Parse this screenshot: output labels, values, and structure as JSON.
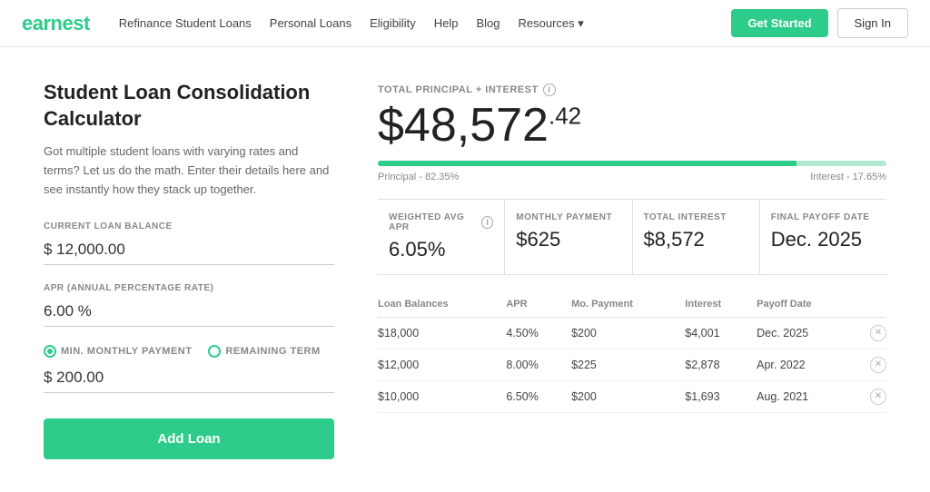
{
  "logo": "earnest",
  "nav": {
    "items": [
      {
        "label": "Refinance Student Loans"
      },
      {
        "label": "Personal Loans"
      },
      {
        "label": "Eligibility"
      },
      {
        "label": "Help"
      },
      {
        "label": "Blog"
      },
      {
        "label": "Resources ▾"
      }
    ]
  },
  "header_actions": {
    "get_started": "Get Started",
    "sign_in": "Sign In"
  },
  "calculator": {
    "title": "Student Loan Consolidation Calculator",
    "description": "Got multiple student loans with varying rates and terms? Let us do the math. Enter their details here and see instantly how they stack up together.",
    "balance_label": "CURRENT LOAN BALANCE",
    "balance_value": "$ 12,000.00",
    "apr_label": "APR (ANNUAL PERCENTAGE RATE)",
    "apr_value": "6.00 %",
    "payment_type_min": "MIN. MONTHLY PAYMENT",
    "payment_type_remaining": "REMAINING TERM",
    "monthly_payment_value": "$ 200.00",
    "add_loan_btn": "Add Loan"
  },
  "results": {
    "total_label": "TOTAL PRINCIPAL + INTEREST",
    "total_whole": "$48,572",
    "total_cents": ".42",
    "principal_label": "Principal - 82.35%",
    "interest_label": "Interest - 17.65%",
    "principal_pct": 82.35,
    "stats": [
      {
        "label": "WEIGHTED AVG APR",
        "value": "6.05%",
        "has_info": true
      },
      {
        "label": "MONTHLY PAYMENT",
        "value": "$625"
      },
      {
        "label": "TOTAL INTEREST",
        "value": "$8,572"
      },
      {
        "label": "FINAL PAYOFF DATE",
        "value": "Dec. 2025"
      }
    ],
    "table": {
      "headers": [
        "Loan Balances",
        "APR",
        "Mo. Payment",
        "Interest",
        "Payoff Date",
        ""
      ],
      "rows": [
        {
          "balance": "$18,000",
          "apr": "4.50%",
          "payment": "$200",
          "interest": "$4,001",
          "payoff": "Dec. 2025"
        },
        {
          "balance": "$12,000",
          "apr": "8.00%",
          "payment": "$225",
          "interest": "$2,878",
          "payoff": "Apr. 2022"
        },
        {
          "balance": "$10,000",
          "apr": "6.50%",
          "payment": "$200",
          "interest": "$1,693",
          "payoff": "Aug. 2021"
        }
      ]
    }
  }
}
